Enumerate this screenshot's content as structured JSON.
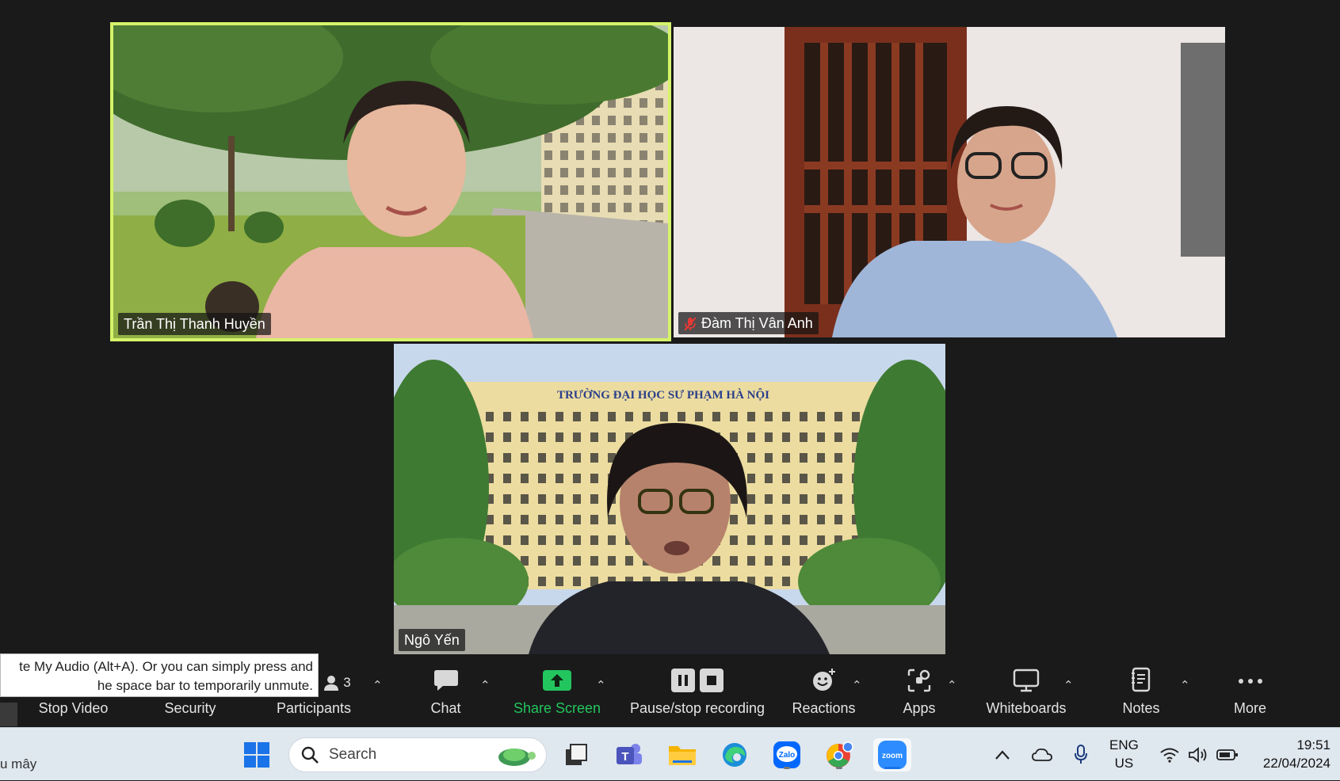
{
  "participants": [
    {
      "name": "Trần Thị Thanh Huyền",
      "muted": false,
      "active_speaker": true
    },
    {
      "name": "Đàm Thị Vân Anh",
      "muted": true,
      "active_speaker": false
    },
    {
      "name": "Ngô Yến",
      "muted": false,
      "active_speaker": false
    }
  ],
  "background_sign": "TRƯỜNG ĐẠI HỌC SƯ PHẠM HÀ NỘI",
  "tooltip": {
    "line1": "te My Audio (Alt+A). Or you can simply press and",
    "line2": "he space bar to temporarily unmute."
  },
  "toolbar": {
    "stop_video": "Stop Video",
    "security": "Security",
    "participants": "Participants",
    "participant_count": "3",
    "chat": "Chat",
    "share_screen": "Share Screen",
    "recording": "Pause/stop recording",
    "reactions": "Reactions",
    "apps": "Apps",
    "whiteboards": "Whiteboards",
    "notes": "Notes",
    "more": "More"
  },
  "taskbar": {
    "weather_text": "u mây",
    "search_placeholder": "Search",
    "apps": [
      "start-icon",
      "search-icon",
      "task-view-icon",
      "teams-icon",
      "file-explorer-icon",
      "edge-icon",
      "zalo-icon",
      "chrome-icon",
      "zoom-icon"
    ],
    "zalo_label": "Zalo",
    "zoom_label": "zoom",
    "teams_label": "T",
    "language_line1": "ENG",
    "language_line2": "US",
    "time": "19:51",
    "date": "22/04/2024"
  },
  "colors": {
    "active_speaker_border": "#d6f36a",
    "share_green": "#22c55e",
    "muted_red": "#e53935",
    "background": "#1a1a1a"
  }
}
